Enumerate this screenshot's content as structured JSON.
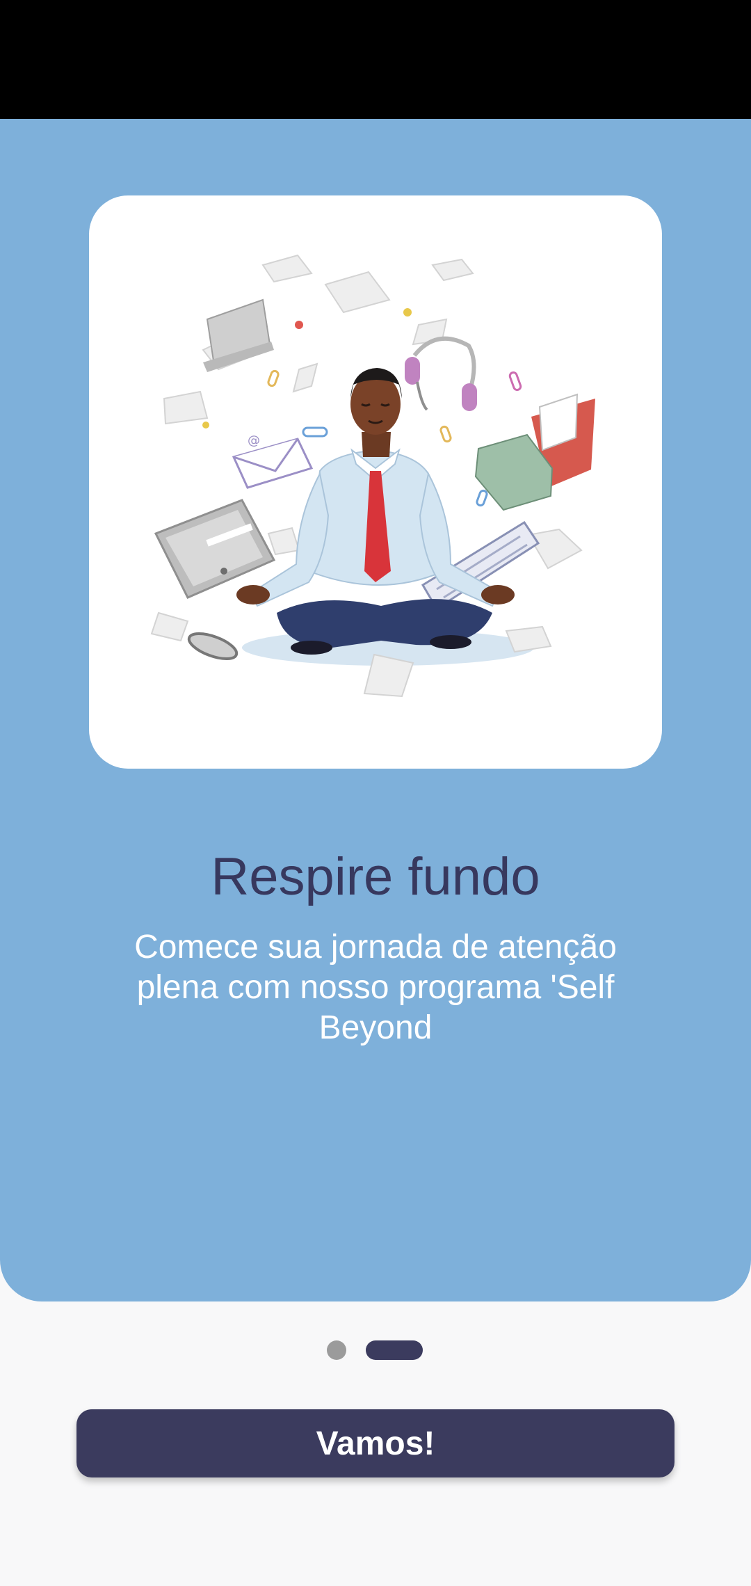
{
  "colors": {
    "hero_background": "#7eb0da",
    "title": "#37385e",
    "primary": "#3b3b5e",
    "dot_inactive": "#9b9b9b",
    "page_background": "#f8f8f9"
  },
  "onboarding": {
    "illustration": "meditating-man-with-flying-office-items",
    "title": "Respire fundo",
    "description": "Comece sua jornada de atenção plena com nosso programa 'Self Beyond",
    "pager": {
      "page_count": 2,
      "current_page": 2
    },
    "cta_label": "Vamos!"
  }
}
